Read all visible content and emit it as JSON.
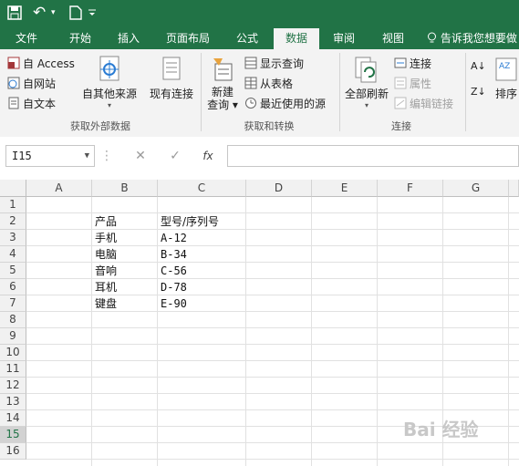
{
  "qat": {
    "undo_label": "↶",
    "redo_label": "▾"
  },
  "tabs": [
    "文件",
    "开始",
    "插入",
    "页面布局",
    "公式",
    "数据",
    "审阅",
    "视图"
  ],
  "active_tab": "数据",
  "tell_me": "告诉我您想要做",
  "ribbon": {
    "external_data": {
      "access": "自 Access",
      "web": "自网站",
      "text": "自文本",
      "other_sources": "自其他来源",
      "existing_connections": "现有连接",
      "label": "获取外部数据"
    },
    "get_transform": {
      "new_query": "新建\n查询",
      "show_queries": "显示查询",
      "from_table": "从表格",
      "recent_sources": "最近使用的源",
      "label": "获取和转换"
    },
    "connections": {
      "refresh_all": "全部刷新",
      "connections": "连接",
      "properties": "属性",
      "edit_links": "编辑链接",
      "label": "连接"
    },
    "sort": {
      "sort_label": "排序"
    }
  },
  "formula_bar": {
    "name_box": "I15",
    "fx": "fx",
    "formula": ""
  },
  "grid": {
    "columns": [
      "A",
      "B",
      "C",
      "D",
      "E",
      "F",
      "G"
    ],
    "rows": [
      "1",
      "2",
      "3",
      "4",
      "5",
      "6",
      "7",
      "8",
      "9",
      "10",
      "11",
      "12",
      "13",
      "14",
      "15",
      "16"
    ],
    "selected_row": "15",
    "cells": {
      "B2": "产品",
      "C2": "型号/序列号",
      "B3": "手机",
      "C3": "A-12",
      "B4": "电脑",
      "C4": "B-34",
      "B5": "音响",
      "C5": "C-56",
      "B6": "耳机",
      "C6": "D-78",
      "B7": "键盘",
      "C7": "E-90"
    }
  },
  "watermark": "Bai 经验"
}
